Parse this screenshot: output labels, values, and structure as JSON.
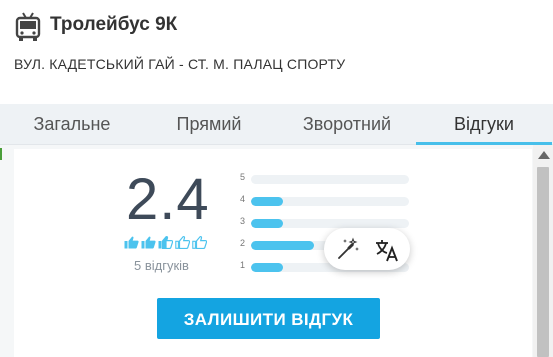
{
  "header": {
    "icon": "trolleybus-icon",
    "title": "Тролейбус 9К",
    "route": "ВУЛ. КАДЕТСЬКИЙ ГАЙ - СТ. М. ПАЛАЦ СПОРТУ"
  },
  "tabs": [
    {
      "label": "Загальне",
      "active": false
    },
    {
      "label": "Прямий",
      "active": false
    },
    {
      "label": "Зворотний",
      "active": false
    },
    {
      "label": "Відгуки",
      "active": true
    }
  ],
  "reviews": {
    "score": "2.4",
    "thumbs_icons": [
      "thumb-up-filled-icon",
      "thumb-up-filled-icon",
      "thumb-up-partial-icon",
      "thumb-up-outline-icon",
      "thumb-up-outline-icon"
    ],
    "count_text": "5 відгуків",
    "distribution": [
      {
        "label": "5",
        "fraction": 0.0
      },
      {
        "label": "4",
        "fraction": 0.2
      },
      {
        "label": "3",
        "fraction": 0.2
      },
      {
        "label": "2",
        "fraction": 0.4
      },
      {
        "label": "1",
        "fraction": 0.2
      }
    ],
    "leave_review_label": "ЗАЛИШИТИ ВІДГУК"
  },
  "floating_tools": {
    "icons": [
      "magic-wand-icon",
      "translate-icon"
    ]
  },
  "colors": {
    "accent": "#47bfea",
    "bar_fill": "#4cc3ee",
    "button": "#14a4e1",
    "score_text": "#3e4a59",
    "tabs_bg": "#eef2f5"
  }
}
